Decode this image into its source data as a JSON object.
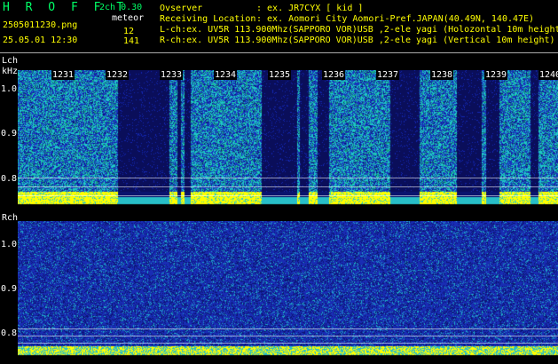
{
  "header": {
    "title": "H R O F F T",
    "mode": "2ch 0.30",
    "category": "meteor",
    "filename": "2505011230.png",
    "datetime": "25.05.01 12:30",
    "l_count": "12",
    "r_count": "141",
    "observer_label": "Ovserver",
    "observer_value": ": ex. JR7CYX [ kid ]",
    "location_label": "Receiving Location",
    "location_value": ": ex. Aomori City Aomori-Pref.JAPAN(40.49N, 140.47E)",
    "lch_info": "L-ch:ex. UV5R 113.900Mhz(SAPPORO VOR)USB ,2-ele yagi (Holozontal 10m height)",
    "rch_info": "R-ch:ex. UV5R 113.900Mhz(SAPPORO VOR)USB ,2-ele yagi (Vertical 10m height)"
  },
  "lch": {
    "label": "Lch",
    "unit": "kHz",
    "y_ticks": [
      "1.0",
      "0.9",
      "0.8"
    ],
    "time_labels": [
      "1231",
      "1232",
      "1233",
      "1234",
      "1235",
      "1236",
      "1237",
      "1238",
      "1239",
      "1240"
    ]
  },
  "rch": {
    "label": "Rch",
    "y_ticks": [
      "1.0",
      "0.9",
      "0.8"
    ]
  },
  "colors": {
    "background": "#000000",
    "title_green": "#00ff66",
    "header_yellow": "#ffff00",
    "noise_blue": "#1a2fc8",
    "noise_cyan": "#27c7c0",
    "signal_yellow": "#ffff00",
    "dark_band": "#0a0f5a"
  }
}
